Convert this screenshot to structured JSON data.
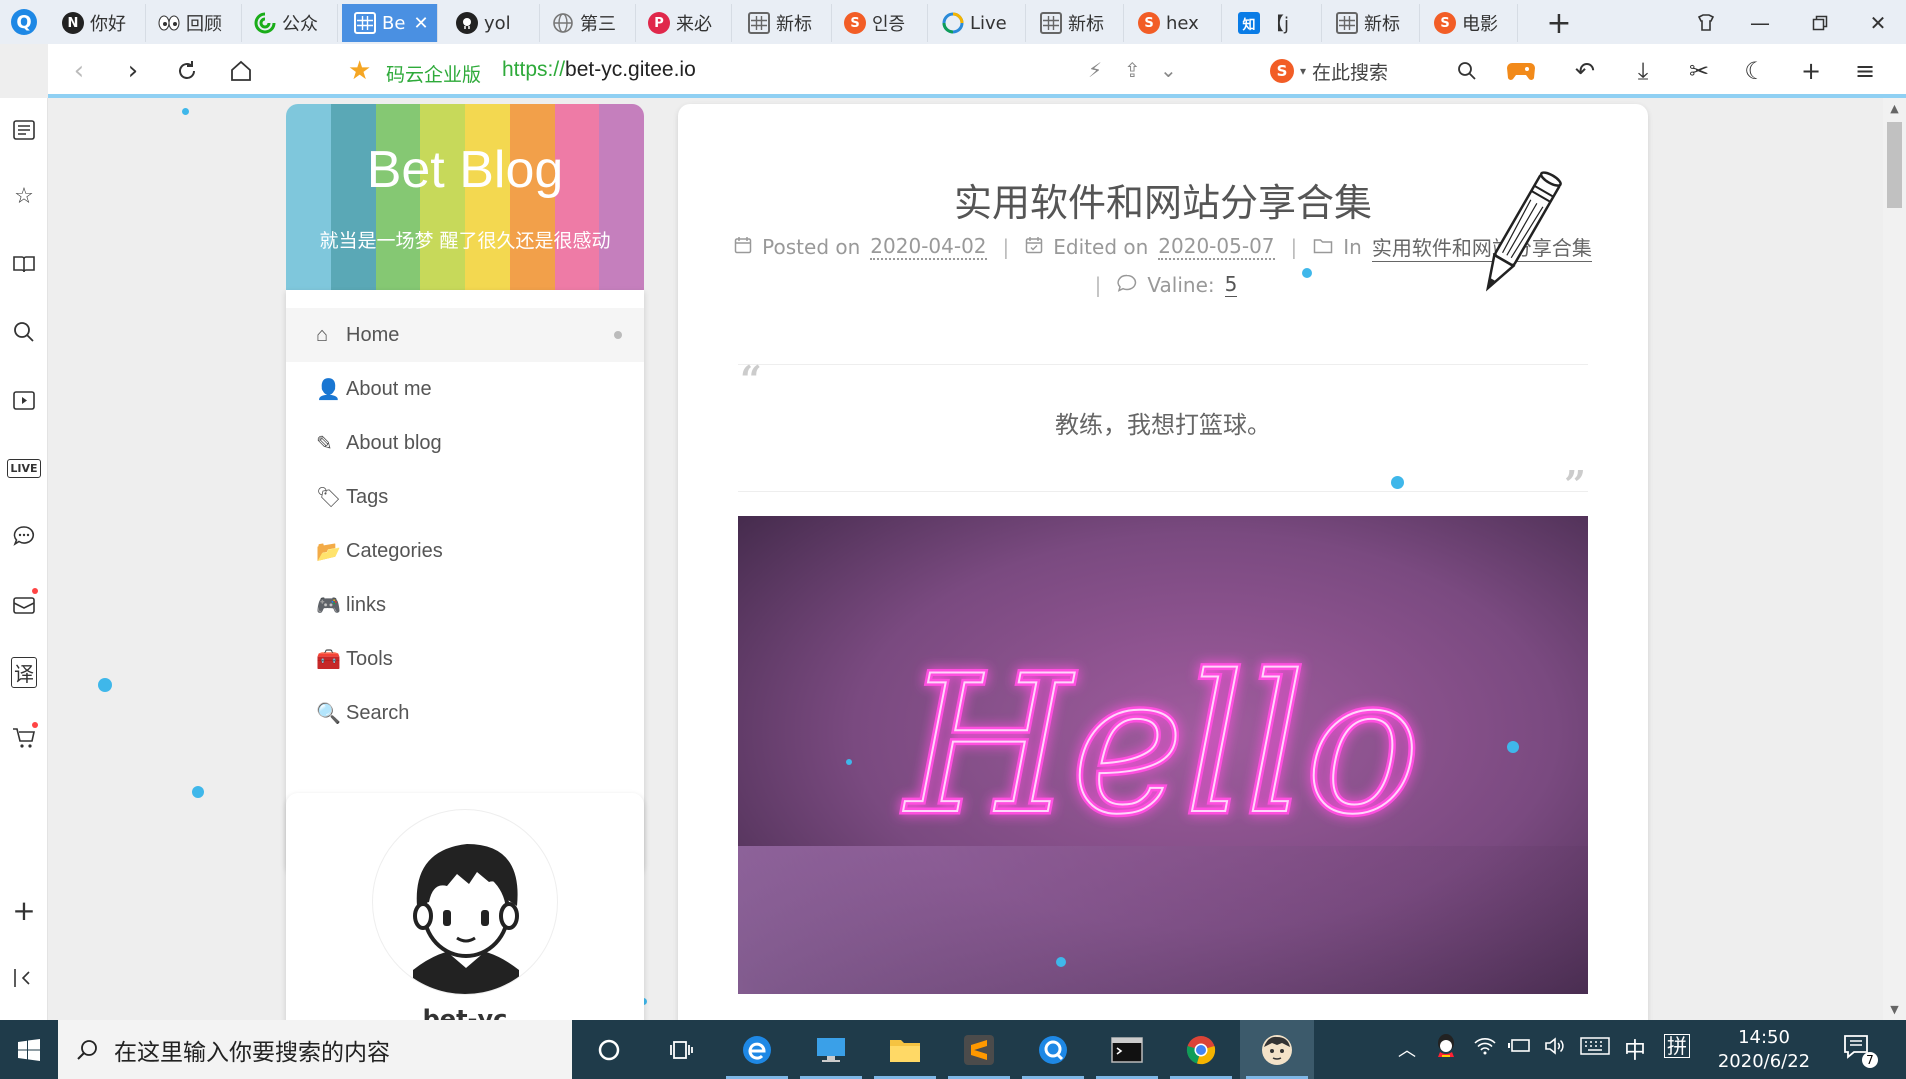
{
  "browser": {
    "tabs": [
      {
        "label": "你好",
        "icon": "N",
        "icon_color": "#222222"
      },
      {
        "label": "回顾",
        "icon": "eyes",
        "icon_color": "#ffffff"
      },
      {
        "label": "公众",
        "icon": "swirl",
        "icon_color": "#1aad19"
      },
      {
        "label": "Be",
        "icon": "grid",
        "icon_color": "#ffffff",
        "active": true
      },
      {
        "label": "yol",
        "icon": "github",
        "icon_color": "#222222"
      },
      {
        "label": "第三",
        "icon": "globe",
        "icon_color": "#888888"
      },
      {
        "label": "来必",
        "icon": "P",
        "icon_color": "#e0284b"
      },
      {
        "label": "新标",
        "icon": "grid",
        "icon_color": "#666666"
      },
      {
        "label": "인증",
        "icon": "S",
        "icon_color": "#f25d26"
      },
      {
        "label": "Live",
        "icon": "live",
        "icon_color": "#2a8ad8"
      },
      {
        "label": "新标",
        "icon": "grid",
        "icon_color": "#666666"
      },
      {
        "label": "hex",
        "icon": "S",
        "icon_color": "#f25d26"
      },
      {
        "label": "【j",
        "icon": "知",
        "icon_color": "#0a7ce6"
      },
      {
        "label": "新标",
        "icon": "grid",
        "icon_color": "#666666"
      },
      {
        "label": "电影",
        "icon": "S",
        "icon_color": "#f25d26"
      }
    ],
    "site_tag": "码云企业版",
    "url_proto": "https://",
    "url_host": "bet-yc.gitee.io",
    "search_placeholder": "在此搜索"
  },
  "blog": {
    "brand_title": "Bet Blog",
    "brand_subtitle": "就当是一场梦 醒了很久还是很感动",
    "brand_stripes": [
      "#7fc7dc",
      "#5aa8b6",
      "#85c873",
      "#c7d95a",
      "#f3d850",
      "#f2a04a",
      "#ee7ba6",
      "#c57fbd"
    ],
    "menu": [
      {
        "label": "Home",
        "icon": "home-icon",
        "glyph": "⌂"
      },
      {
        "label": "About me",
        "icon": "user-edit-icon",
        "glyph": "👤"
      },
      {
        "label": "About blog",
        "icon": "file-signature-icon",
        "glyph": "✎"
      },
      {
        "label": "Tags",
        "icon": "tags-icon",
        "glyph": "🏷"
      },
      {
        "label": "Categories",
        "icon": "folder-open-icon",
        "glyph": "📂"
      },
      {
        "label": "links",
        "icon": "gamepad-icon",
        "glyph": "🎮"
      },
      {
        "label": "Tools",
        "icon": "toolbox-icon",
        "glyph": "🧰"
      },
      {
        "label": "Search",
        "icon": "search-icon",
        "glyph": "🔍"
      }
    ],
    "author_name": "bet-yc"
  },
  "post": {
    "title": "实用软件和网站分享合集",
    "posted_label": "Posted on",
    "posted_date": "2020-04-02",
    "edited_label": "Edited on",
    "edited_date": "2020-05-07",
    "in_label": "In",
    "category": "实用软件和网站分享合集",
    "valine_label": "Valine:",
    "valine_count": "5",
    "quote": "教练，我想打篮球。",
    "hero_text": "Hello"
  },
  "taskbar": {
    "search_placeholder": "在这里输入你要搜索的内容",
    "ime_lang": "中",
    "ime_mode": "拼",
    "time": "14:50",
    "date": "2020/6/22",
    "notifications": "7"
  },
  "colors": {
    "accent": "#4a90e2",
    "dots": "#3fb7ea",
    "neon": "#ff4fe0"
  }
}
